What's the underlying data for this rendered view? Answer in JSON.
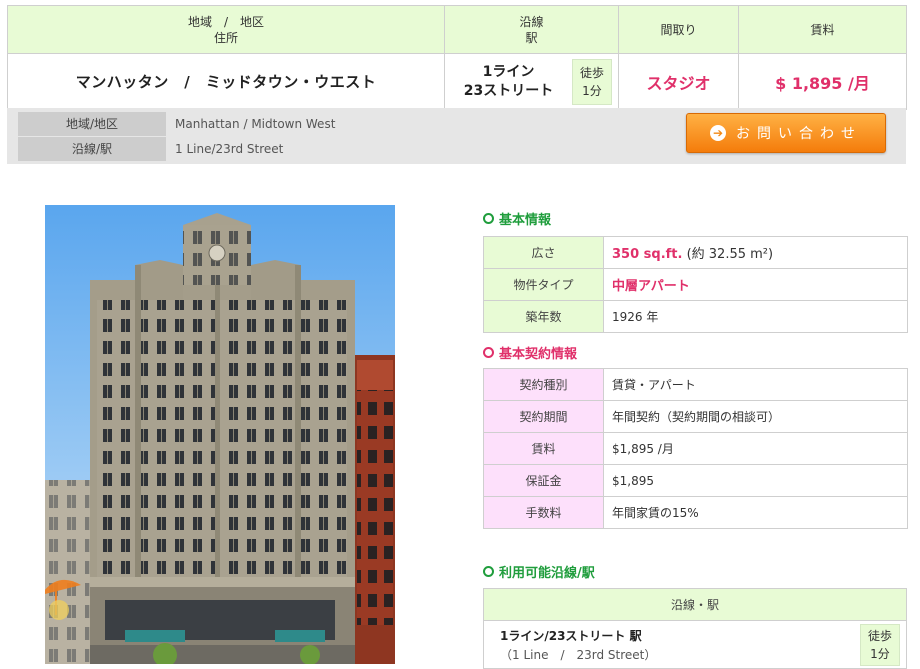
{
  "summary": {
    "headers": {
      "area_line1": "地域　/　地区",
      "area_line2": "住所",
      "line_line1": "沿線",
      "line_line2": "駅",
      "layout": "間取り",
      "rent": "賃料"
    },
    "area_value": "マンハッタン　/　ミッドタウン・ウエスト",
    "line_value_1": "1ライン",
    "line_value_2": "23ストリート",
    "walk_1": "徒歩",
    "walk_2": "1分",
    "layout_value": "スタジオ",
    "rent_value": "$ 1,895 /月"
  },
  "subbar": {
    "area_label": "地域/地区",
    "area_value": "Manhattan / Midtown West",
    "line_label": "沿線/駅",
    "line_value": "1 Line/23rd Street",
    "contact_label": "お問い合わせ"
  },
  "basic": {
    "title": "基本情報",
    "rows": [
      {
        "label": "広さ",
        "value_strong": "350 sq.ft.",
        "value_rest": " (約 32.55 m²)"
      },
      {
        "label": "物件タイプ",
        "value_strong": "中層アパート",
        "value_rest": ""
      },
      {
        "label": "築年数",
        "value_strong": "",
        "value_rest": "1926 年"
      }
    ]
  },
  "contract": {
    "title": "基本契約情報",
    "rows": [
      {
        "label": "契約種別",
        "value": "賃貸・アパート"
      },
      {
        "label": "契約期間",
        "value": "年間契約（契約期間の相談可）"
      },
      {
        "label": "賃料",
        "value": "$1,895 /月"
      },
      {
        "label": "保証金",
        "value": "$1,895"
      },
      {
        "label": "手数料",
        "value": "年間家賃の15%"
      }
    ]
  },
  "stations": {
    "title": "利用可能沿線/駅",
    "header": "沿線・駅",
    "row_name": "1ライン/23ストリート 駅",
    "row_sub": "（1 Line　/　23rd Street）",
    "walk_1": "徒歩",
    "walk_2": "1分"
  },
  "colors": {
    "green_header": "#e8fbd5",
    "pink_label": "#fde0fb",
    "accent_pink": "#e0306a",
    "accent_green": "#1f9d3c",
    "cta_orange": "#f28a18"
  }
}
